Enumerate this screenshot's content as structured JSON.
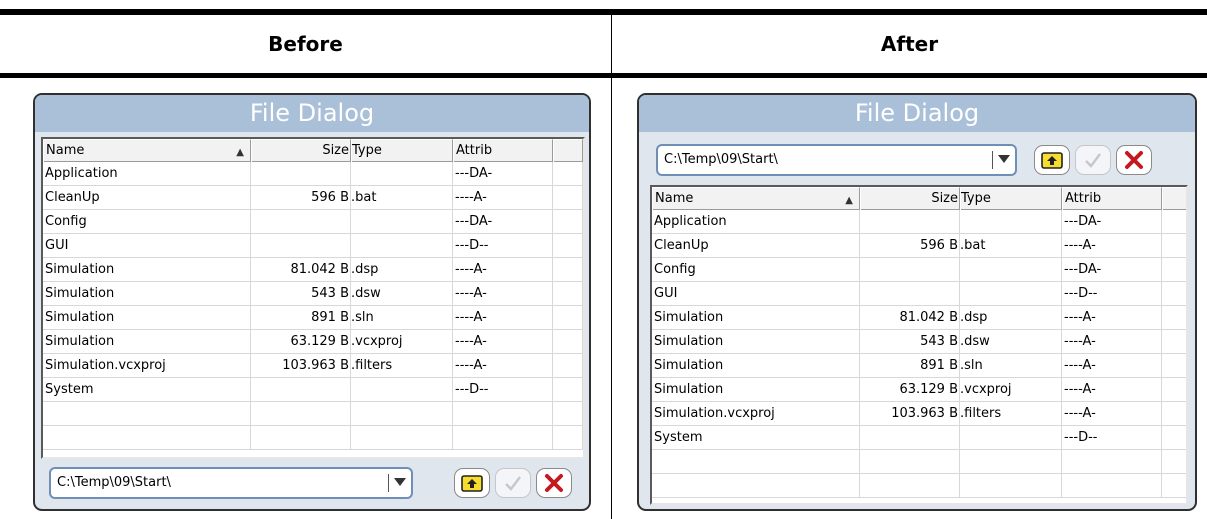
{
  "headers": {
    "before": "Before",
    "after": "After"
  },
  "dialog": {
    "title": "File Dialog",
    "path": "C:\\Temp\\09\\Start\\",
    "columns": [
      "Name",
      "Size",
      "Type",
      "Attrib"
    ],
    "rows": [
      {
        "name": "Application",
        "size": "",
        "type": "",
        "attrib": "---DA-"
      },
      {
        "name": "CleanUp",
        "size": "596 B",
        "type": ".bat",
        "attrib": "----A-"
      },
      {
        "name": "Config",
        "size": "",
        "type": "",
        "attrib": "---DA-"
      },
      {
        "name": "GUI",
        "size": "",
        "type": "",
        "attrib": "---D--"
      },
      {
        "name": "Simulation",
        "size": "81.042 B",
        "type": ".dsp",
        "attrib": "----A-"
      },
      {
        "name": "Simulation",
        "size": "543 B",
        "type": ".dsw",
        "attrib": "----A-"
      },
      {
        "name": "Simulation",
        "size": "891 B",
        "type": ".sln",
        "attrib": "----A-"
      },
      {
        "name": "Simulation",
        "size": "63.129 B",
        "type": ".vcxproj",
        "attrib": "----A-"
      },
      {
        "name": "Simulation.vcxproj",
        "size": "103.963 B",
        "type": ".filters",
        "attrib": "----A-"
      },
      {
        "name": "System",
        "size": "",
        "type": "",
        "attrib": "---D--"
      }
    ],
    "buttons": [
      "folder-up-icon",
      "checkmark-icon",
      "close-icon"
    ],
    "colors": {
      "title_bar": "#a9c0d8",
      "accent": "#6f8fb8",
      "close_red": "#c4191f",
      "folder_yellow": "#f7dd2e"
    }
  }
}
